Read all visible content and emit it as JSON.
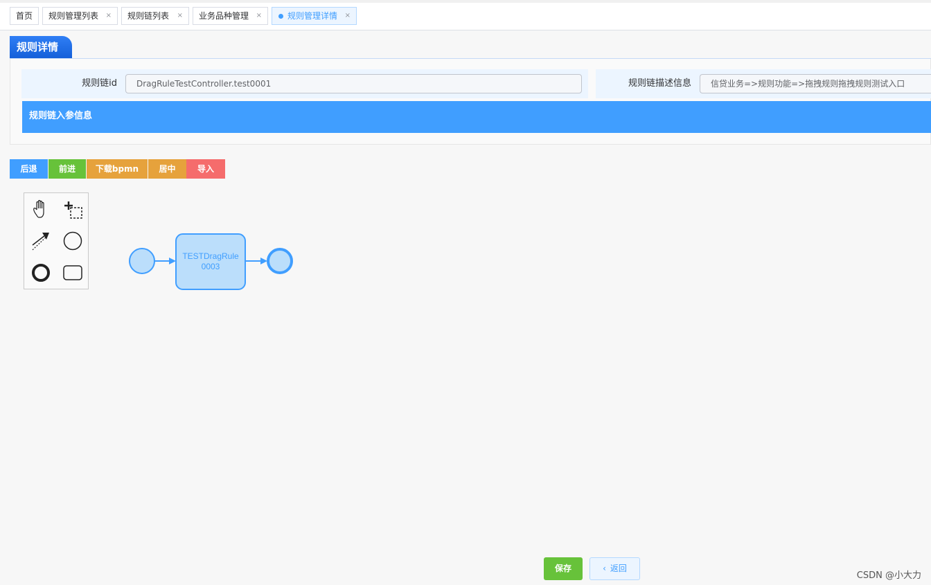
{
  "tabs": [
    {
      "label": "首页",
      "closable": false
    },
    {
      "label": "规则管理列表",
      "closable": true
    },
    {
      "label": "规则链列表",
      "closable": true
    },
    {
      "label": "业务品种管理",
      "closable": true
    },
    {
      "label": "规则管理详情",
      "closable": true,
      "active": true
    }
  ],
  "close_glyph": "×",
  "section_title": "规则详情",
  "form": {
    "chain_id_label": "规则链id",
    "chain_id_value": "DragRuleTestController.test0001",
    "desc_label": "规则链描述信息",
    "desc_value": "信贷业务=>规则功能=>拖拽规则拖拽规则测试入口"
  },
  "params_bar": "规则链入参信息",
  "toolbar": {
    "back": "后退",
    "forward": "前进",
    "download": "下载bpmn",
    "center": "居中",
    "import": "导入"
  },
  "palette": [
    "hand-tool",
    "lasso-tool",
    "connect-tool",
    "start-event",
    "end-event",
    "task"
  ],
  "diagram": {
    "task_line1": "TESTDragRule",
    "task_line2": "0003"
  },
  "footer": {
    "save": "保存",
    "back_icon": "‹",
    "back": "返回",
    "watermark": "CSDN @小大力"
  },
  "colors": {
    "primary": "#409eff",
    "success": "#67c23a",
    "warning": "#e6a23c",
    "danger": "#f56c6c"
  }
}
